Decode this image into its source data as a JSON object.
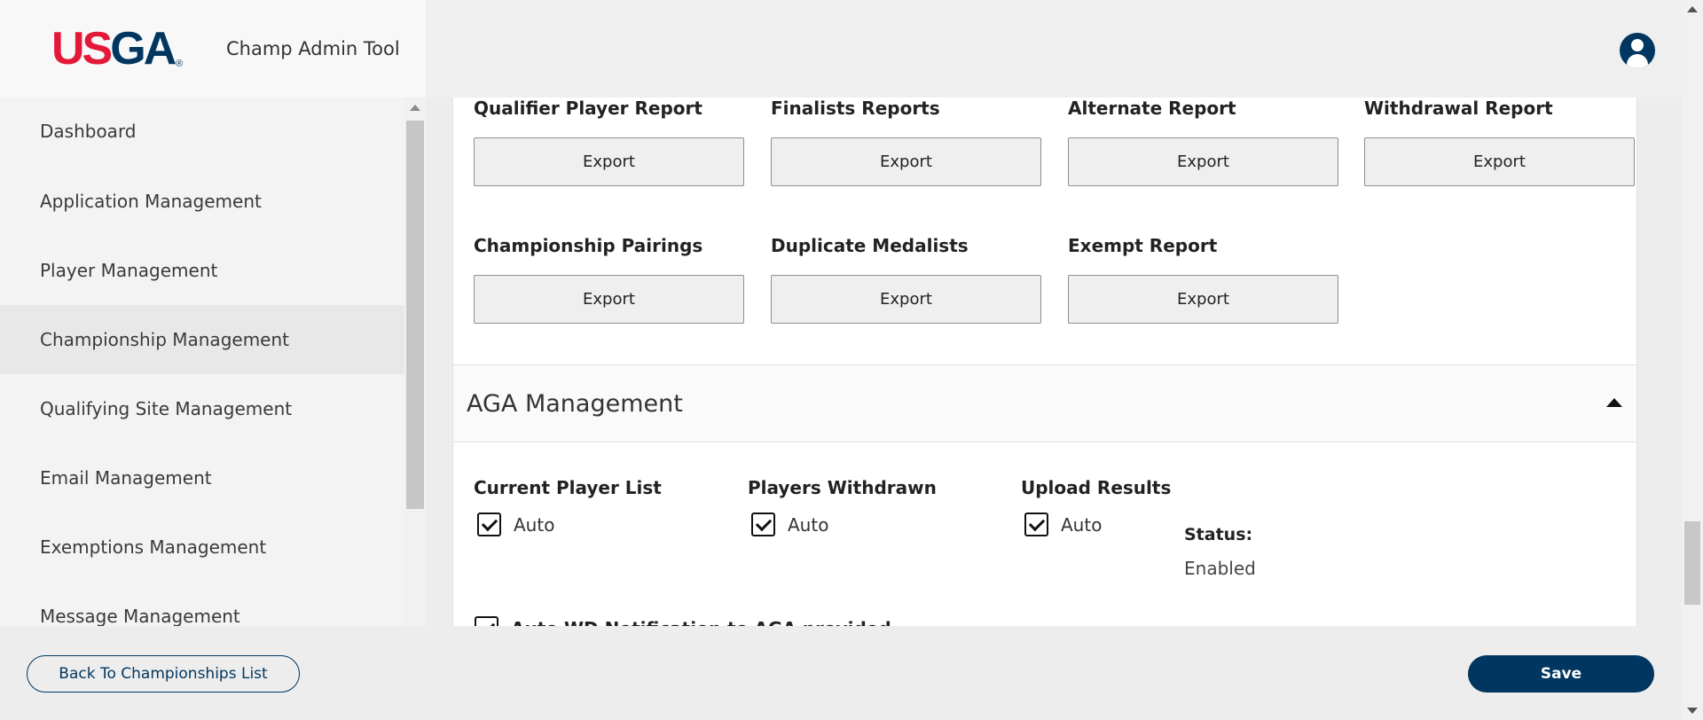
{
  "header": {
    "logo_us": "US",
    "logo_ga": "GA",
    "logo_reg": "®",
    "app_title": "Champ Admin Tool",
    "user_icon": "user-circle-icon"
  },
  "sidebar": {
    "items": [
      {
        "label": "Dashboard"
      },
      {
        "label": "Application Management"
      },
      {
        "label": "Player Management"
      },
      {
        "label": "Championship Management",
        "active": true
      },
      {
        "label": "Qualifying Site Management"
      },
      {
        "label": "Email Management"
      },
      {
        "label": "Exemptions Management"
      },
      {
        "label": "Message Management"
      }
    ]
  },
  "reports": {
    "export_label": "Export",
    "items": [
      {
        "label": "Qualifier Player Report"
      },
      {
        "label": "Finalists Reports"
      },
      {
        "label": "Alternate Report"
      },
      {
        "label": "Withdrawal Report"
      },
      {
        "label": "Championship Pairings"
      },
      {
        "label": "Duplicate Medalists"
      },
      {
        "label": "Exempt Report"
      }
    ]
  },
  "aga": {
    "title": "AGA Management",
    "toggle_icon": "caret-up-icon",
    "columns": [
      {
        "label": "Current Player List",
        "checkbox_label": "Auto",
        "checked": true
      },
      {
        "label": "Players Withdrawn",
        "checkbox_label": "Auto",
        "checked": true
      },
      {
        "label": "Upload Results",
        "checkbox_label": "Auto",
        "checked": true
      }
    ],
    "status_label": "Status:",
    "status_value": "Enabled",
    "partial_row_label": "Auto WD Notification to AGA provided"
  },
  "footer": {
    "back_label": "Back To Championships List",
    "save_label": "Save"
  },
  "colors": {
    "brand_navy": "#00365f",
    "brand_red": "#e31937"
  }
}
